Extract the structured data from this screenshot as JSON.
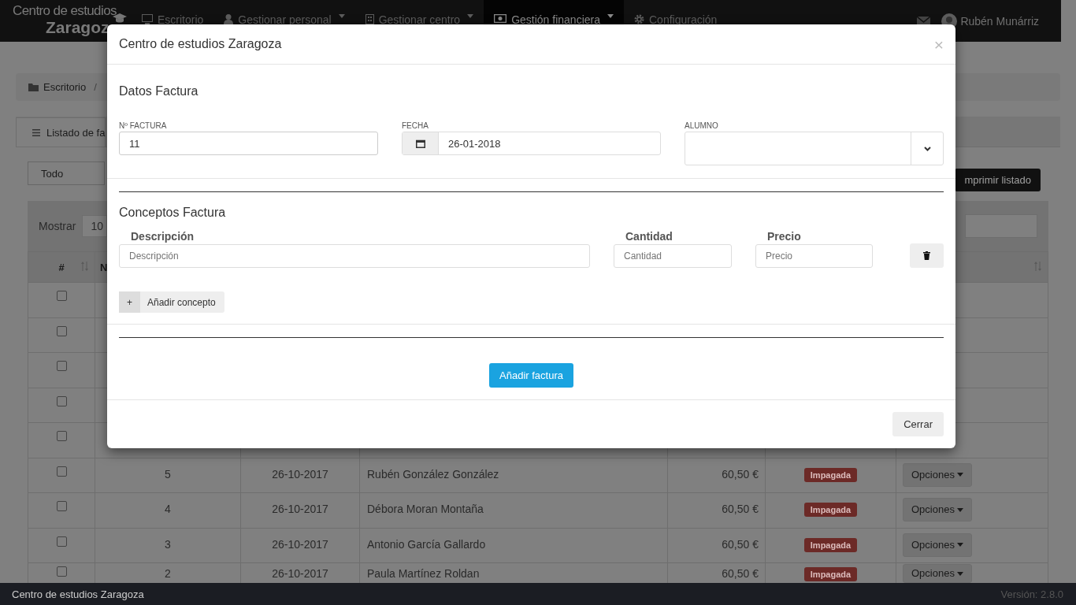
{
  "navbar": {
    "brand_title": "Centro de estudios",
    "brand_subtitle": "Zaragoz",
    "items": [
      {
        "label": "Escritorio",
        "selected": false,
        "has_menu": false
      },
      {
        "label": "Gestionar personal",
        "selected": false,
        "has_menu": true
      },
      {
        "label": "Gestionar centro",
        "selected": false,
        "has_menu": true
      },
      {
        "label": "Gestión financiera",
        "selected": true,
        "has_menu": true
      },
      {
        "label": "Configuración",
        "selected": false,
        "has_menu": false
      }
    ],
    "user": "Rubén Munárriz"
  },
  "breadcrumb": {
    "items": [
      "Escritorio"
    ],
    "separator": "/"
  },
  "panel": {
    "tab": "Listado de fa",
    "filter": "Todo",
    "print_button": "mprimir listado",
    "show_label": "Mostrar",
    "show_value": "10",
    "columns": [
      "#",
      "N"
    ],
    "rows": [
      {
        "checked": false
      },
      {
        "checked": false
      },
      {
        "checked": false
      },
      {
        "checked": false
      },
      {
        "checked": false
      },
      {
        "checked": false,
        "number": "5",
        "date": "26-10-2017",
        "name": "Rubén González González",
        "amount": "60,50 €",
        "status": "Impagada",
        "action": "Opciones"
      },
      {
        "checked": false,
        "number": "4",
        "date": "26-10-2017",
        "name": "Débora Moran Montaña",
        "amount": "60,50 €",
        "status": "Impagada",
        "action": "Opciones"
      },
      {
        "checked": false,
        "number": "3",
        "date": "26-10-2017",
        "name": "Antonio García Gallardo",
        "amount": "60,50 €",
        "status": "Impagada",
        "action": "Opciones"
      },
      {
        "checked": false,
        "number": "2",
        "date": "26-10-2017",
        "name": "Paula Martínez Roldan",
        "amount": "60,50 €",
        "status": "Impagada",
        "action": "Opciones"
      }
    ]
  },
  "modal": {
    "title": "Centro de estudios Zaragoza",
    "close": "×",
    "invoice_section": "Datos Factura",
    "invoice_number": {
      "label": "Nº FACTURA",
      "value": "11"
    },
    "date": {
      "label": "FECHA",
      "value": "26-01-2018"
    },
    "student": {
      "label": "ALUMNO"
    },
    "concepts_section": "Conceptos Factura",
    "concept_columns": [
      "Descripción",
      "Cantidad",
      "Precio"
    ],
    "concepts": [
      {
        "description": {
          "placeholder": "Descripción"
        },
        "quantity": {
          "placeholder": "Cantidad"
        },
        "price": {
          "placeholder": "Precio"
        }
      }
    ],
    "add_concept": {
      "icon": "+",
      "label": "Añadir concepto"
    },
    "submit": "Añadir factura",
    "footer_button": "Cerrar"
  },
  "footer": {
    "left": "Centro de estudios Zaragoza",
    "version": "Versión: 2.8.0"
  }
}
